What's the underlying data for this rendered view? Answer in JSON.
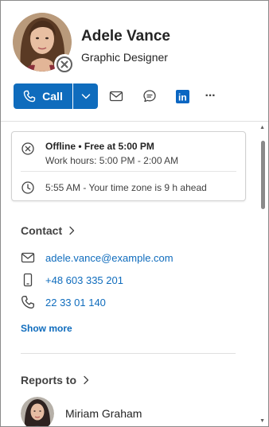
{
  "person": {
    "name": "Adele Vance",
    "job_title": "Graphic Designer",
    "presence": "offline"
  },
  "actions": {
    "call_label": "Call",
    "icons": [
      "phone-icon",
      "chevron-down-icon",
      "mail-icon",
      "chat-icon",
      "linkedin-icon",
      "more-icon"
    ],
    "linkedin_text": "in",
    "more_text": "···"
  },
  "status": {
    "availability": "Offline • Free at 5:00 PM",
    "work_hours": "Work hours: 5:00 PM - 2:00 AM",
    "local_time": "5:55 AM - Your time zone is 9 h ahead"
  },
  "contact": {
    "heading": "Contact",
    "email": "adele.vance@example.com",
    "mobile": "+48 603 335 201",
    "phone": "22 33 01 140",
    "show_more": "Show more"
  },
  "reports_to": {
    "heading": "Reports to",
    "manager_name": "Miriam Graham"
  },
  "colors": {
    "accent": "#0f6cbd",
    "text": "#242424",
    "linkedin": "#0a66c2"
  }
}
